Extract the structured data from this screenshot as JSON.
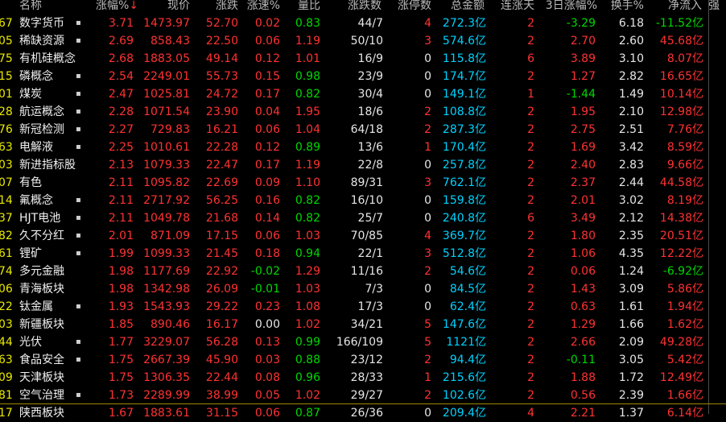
{
  "headers": {
    "name": "名称",
    "change_pct": "涨幅%",
    "sort_marker": "↓",
    "price": "现价",
    "change": "涨跌",
    "speed": "涨速%",
    "vol_ratio": "量比",
    "up_down": "涨跌数",
    "limit_up": "涨停数",
    "amount": "总金额",
    "streak": "连涨天",
    "three_day": "3日涨幅%",
    "turnover": "换手%",
    "net_inflow": "净流入",
    "strength": "强"
  },
  "colors": {
    "up": "#ff3232",
    "down": "#00d700",
    "flat": "#e6e6e6",
    "amount": "#00d2ff",
    "code": "#e8e800"
  },
  "rows": [
    {
      "code": "67",
      "name": "数字货币",
      "dot": "▪",
      "change_pct": "3.71",
      "price": "1473.97",
      "change": "52.70",
      "speed": "0.02",
      "vol_ratio": "0.83",
      "up_down": "44/7",
      "limit_up": "4",
      "amount": "272.3",
      "amount_unit": "亿",
      "streak": "2",
      "three_day": "-3.29",
      "turnover": "6.18",
      "net_inflow": "-11.52",
      "inflow_unit": "亿"
    },
    {
      "code": "05",
      "name": "稀缺资源",
      "dot": "▪",
      "change_pct": "2.69",
      "price": "858.43",
      "change": "22.50",
      "speed": "0.06",
      "vol_ratio": "1.19",
      "up_down": "50/10",
      "limit_up": "3",
      "amount": "574.6",
      "amount_unit": "亿",
      "streak": "2",
      "three_day": "2.70",
      "turnover": "2.60",
      "net_inflow": "45.68",
      "inflow_unit": "亿"
    },
    {
      "code": "75",
      "name": "有机硅概念",
      "dot": "",
      "change_pct": "2.68",
      "price": "1883.05",
      "change": "49.14",
      "speed": "0.12",
      "vol_ratio": "1.01",
      "up_down": "16/9",
      "limit_up": "0",
      "amount": "115.8",
      "amount_unit": "亿",
      "streak": "6",
      "three_day": "3.89",
      "turnover": "3.10",
      "net_inflow": "8.07",
      "inflow_unit": "亿"
    },
    {
      "code": "15",
      "name": "磷概念",
      "dot": "▪",
      "change_pct": "2.54",
      "price": "2249.01",
      "change": "55.73",
      "speed": "0.15",
      "vol_ratio": "0.98",
      "up_down": "23/9",
      "limit_up": "0",
      "amount": "174.7",
      "amount_unit": "亿",
      "streak": "2",
      "three_day": "1.27",
      "turnover": "2.82",
      "net_inflow": "16.65",
      "inflow_unit": "亿"
    },
    {
      "code": "01",
      "name": "煤炭",
      "dot": "▪",
      "change_pct": "2.47",
      "price": "1025.81",
      "change": "24.72",
      "speed": "0.17",
      "vol_ratio": "0.82",
      "up_down": "30/4",
      "limit_up": "0",
      "amount": "149.1",
      "amount_unit": "亿",
      "streak": "1",
      "three_day": "-1.44",
      "turnover": "1.49",
      "net_inflow": "10.14",
      "inflow_unit": "亿"
    },
    {
      "code": "28",
      "name": "航运概念",
      "dot": "▪",
      "change_pct": "2.28",
      "price": "1071.54",
      "change": "23.90",
      "speed": "0.04",
      "vol_ratio": "1.95",
      "up_down": "18/6",
      "limit_up": "2",
      "amount": "108.8",
      "amount_unit": "亿",
      "streak": "2",
      "three_day": "1.95",
      "turnover": "2.10",
      "net_inflow": "12.98",
      "inflow_unit": "亿"
    },
    {
      "code": "76",
      "name": "新冠检测",
      "dot": "▪",
      "change_pct": "2.27",
      "price": "729.83",
      "change": "16.21",
      "speed": "0.06",
      "vol_ratio": "1.04",
      "up_down": "64/18",
      "limit_up": "2",
      "amount": "287.3",
      "amount_unit": "亿",
      "streak": "2",
      "three_day": "2.75",
      "turnover": "2.51",
      "net_inflow": "7.76",
      "inflow_unit": "亿"
    },
    {
      "code": "63",
      "name": "电解液",
      "dot": "▪",
      "change_pct": "2.25",
      "price": "1010.61",
      "change": "22.28",
      "speed": "0.12",
      "vol_ratio": "0.89",
      "up_down": "13/6",
      "limit_up": "1",
      "amount": "170.4",
      "amount_unit": "亿",
      "streak": "2",
      "three_day": "1.69",
      "turnover": "3.42",
      "net_inflow": "8.59",
      "inflow_unit": "亿"
    },
    {
      "code": "03",
      "name": "新进指标股",
      "dot": "",
      "change_pct": "2.13",
      "price": "1079.33",
      "change": "22.47",
      "speed": "0.17",
      "vol_ratio": "1.19",
      "up_down": "22/8",
      "limit_up": "0",
      "amount": "257.8",
      "amount_unit": "亿",
      "streak": "2",
      "three_day": "2.40",
      "turnover": "2.83",
      "net_inflow": "9.66",
      "inflow_unit": "亿"
    },
    {
      "code": "07",
      "name": "有色",
      "dot": "",
      "change_pct": "2.11",
      "price": "1095.82",
      "change": "22.69",
      "speed": "0.09",
      "vol_ratio": "1.10",
      "up_down": "89/31",
      "limit_up": "3",
      "amount": "762.1",
      "amount_unit": "亿",
      "streak": "2",
      "three_day": "2.37",
      "turnover": "2.44",
      "net_inflow": "44.58",
      "inflow_unit": "亿"
    },
    {
      "code": "14",
      "name": "氟概念",
      "dot": "▪",
      "change_pct": "2.11",
      "price": "2717.92",
      "change": "56.25",
      "speed": "0.16",
      "vol_ratio": "0.82",
      "up_down": "16/10",
      "limit_up": "0",
      "amount": "159.8",
      "amount_unit": "亿",
      "streak": "2",
      "three_day": "2.01",
      "turnover": "3.02",
      "net_inflow": "8.19",
      "inflow_unit": "亿"
    },
    {
      "code": "37",
      "name": "HJT电池",
      "dot": "▪",
      "change_pct": "2.11",
      "price": "1049.78",
      "change": "21.68",
      "speed": "0.14",
      "vol_ratio": "0.82",
      "up_down": "25/7",
      "limit_up": "0",
      "amount": "240.8",
      "amount_unit": "亿",
      "streak": "6",
      "three_day": "3.49",
      "turnover": "2.12",
      "net_inflow": "14.38",
      "inflow_unit": "亿"
    },
    {
      "code": "82",
      "name": "久不分红",
      "dot": "▪",
      "change_pct": "2.01",
      "price": "871.09",
      "change": "17.15",
      "speed": "0.06",
      "vol_ratio": "1.03",
      "up_down": "70/85",
      "limit_up": "4",
      "amount": "369.7",
      "amount_unit": "亿",
      "streak": "2",
      "three_day": "1.80",
      "turnover": "2.35",
      "net_inflow": "20.51",
      "inflow_unit": "亿"
    },
    {
      "code": "61",
      "name": "锂矿",
      "dot": "▪",
      "change_pct": "1.99",
      "price": "1099.33",
      "change": "21.45",
      "speed": "0.18",
      "vol_ratio": "0.94",
      "up_down": "22/1",
      "limit_up": "3",
      "amount": "512.8",
      "amount_unit": "亿",
      "streak": "2",
      "three_day": "1.06",
      "turnover": "4.35",
      "net_inflow": "12.22",
      "inflow_unit": "亿"
    },
    {
      "code": "74",
      "name": "多元金融",
      "dot": "",
      "change_pct": "1.98",
      "price": "1177.69",
      "change": "22.92",
      "speed": "-0.02",
      "vol_ratio": "1.29",
      "up_down": "11/16",
      "limit_up": "2",
      "amount": "54.6",
      "amount_unit": "亿",
      "streak": "2",
      "three_day": "0.06",
      "turnover": "1.24",
      "net_inflow": "-6.92",
      "inflow_unit": "亿"
    },
    {
      "code": "06",
      "name": "青海板块",
      "dot": "",
      "change_pct": "1.98",
      "price": "1342.98",
      "change": "26.09",
      "speed": "-0.01",
      "vol_ratio": "1.03",
      "up_down": "7/3",
      "limit_up": "0",
      "amount": "84.5",
      "amount_unit": "亿",
      "streak": "2",
      "three_day": "1.43",
      "turnover": "3.09",
      "net_inflow": "5.86",
      "inflow_unit": "亿"
    },
    {
      "code": "22",
      "name": "钛金属",
      "dot": "▪",
      "change_pct": "1.93",
      "price": "1543.93",
      "change": "29.22",
      "speed": "0.23",
      "vol_ratio": "1.08",
      "up_down": "17/3",
      "limit_up": "0",
      "amount": "62.4",
      "amount_unit": "亿",
      "streak": "2",
      "three_day": "0.63",
      "turnover": "1.61",
      "net_inflow": "1.94",
      "inflow_unit": "亿"
    },
    {
      "code": "03",
      "name": "新疆板块",
      "dot": "",
      "change_pct": "1.85",
      "price": "890.46",
      "change": "16.17",
      "speed": "0.00",
      "vol_ratio": "1.02",
      "up_down": "34/21",
      "limit_up": "5",
      "amount": "147.6",
      "amount_unit": "亿",
      "streak": "2",
      "three_day": "1.29",
      "turnover": "1.66",
      "net_inflow": "1.62",
      "inflow_unit": "亿"
    },
    {
      "code": "44",
      "name": "光伏",
      "dot": "▪",
      "change_pct": "1.77",
      "price": "3229.07",
      "change": "56.28",
      "speed": "0.13",
      "vol_ratio": "0.99",
      "up_down": "166/109",
      "limit_up": "5",
      "amount": "1121",
      "amount_unit": "亿",
      "streak": "2",
      "three_day": "2.66",
      "turnover": "2.09",
      "net_inflow": "49.28",
      "inflow_unit": "亿"
    },
    {
      "code": "63",
      "name": "食品安全",
      "dot": "▪",
      "change_pct": "1.75",
      "price": "2667.39",
      "change": "45.90",
      "speed": "0.03",
      "vol_ratio": "0.88",
      "up_down": "23/12",
      "limit_up": "2",
      "amount": "94.4",
      "amount_unit": "亿",
      "streak": "2",
      "three_day": "-0.11",
      "turnover": "3.05",
      "net_inflow": "5.42",
      "inflow_unit": "亿"
    },
    {
      "code": "09",
      "name": "天津板块",
      "dot": "",
      "change_pct": "1.75",
      "price": "1306.35",
      "change": "22.44",
      "speed": "0.08",
      "vol_ratio": "0.96",
      "up_down": "28/33",
      "limit_up": "1",
      "amount": "215.6",
      "amount_unit": "亿",
      "streak": "2",
      "three_day": "1.88",
      "turnover": "1.72",
      "net_inflow": "12.49",
      "inflow_unit": "亿"
    },
    {
      "code": "81",
      "name": "空气治理",
      "dot": "▪",
      "change_pct": "1.73",
      "price": "2289.99",
      "change": "38.99",
      "speed": "0.05",
      "vol_ratio": "1.02",
      "up_down": "29/27",
      "limit_up": "2",
      "amount": "102.6",
      "amount_unit": "亿",
      "streak": "2",
      "three_day": "0.56",
      "turnover": "2.39",
      "net_inflow": "1.66",
      "inflow_unit": "亿"
    },
    {
      "code": "17",
      "name": "陕西板块",
      "dot": "",
      "change_pct": "1.67",
      "price": "1883.61",
      "change": "31.15",
      "speed": "0.06",
      "vol_ratio": "0.87",
      "up_down": "26/36",
      "limit_up": "0",
      "amount": "209.4",
      "amount_unit": "亿",
      "streak": "4",
      "three_day": "2.21",
      "turnover": "1.37",
      "net_inflow": "6.14",
      "inflow_unit": "亿"
    }
  ]
}
